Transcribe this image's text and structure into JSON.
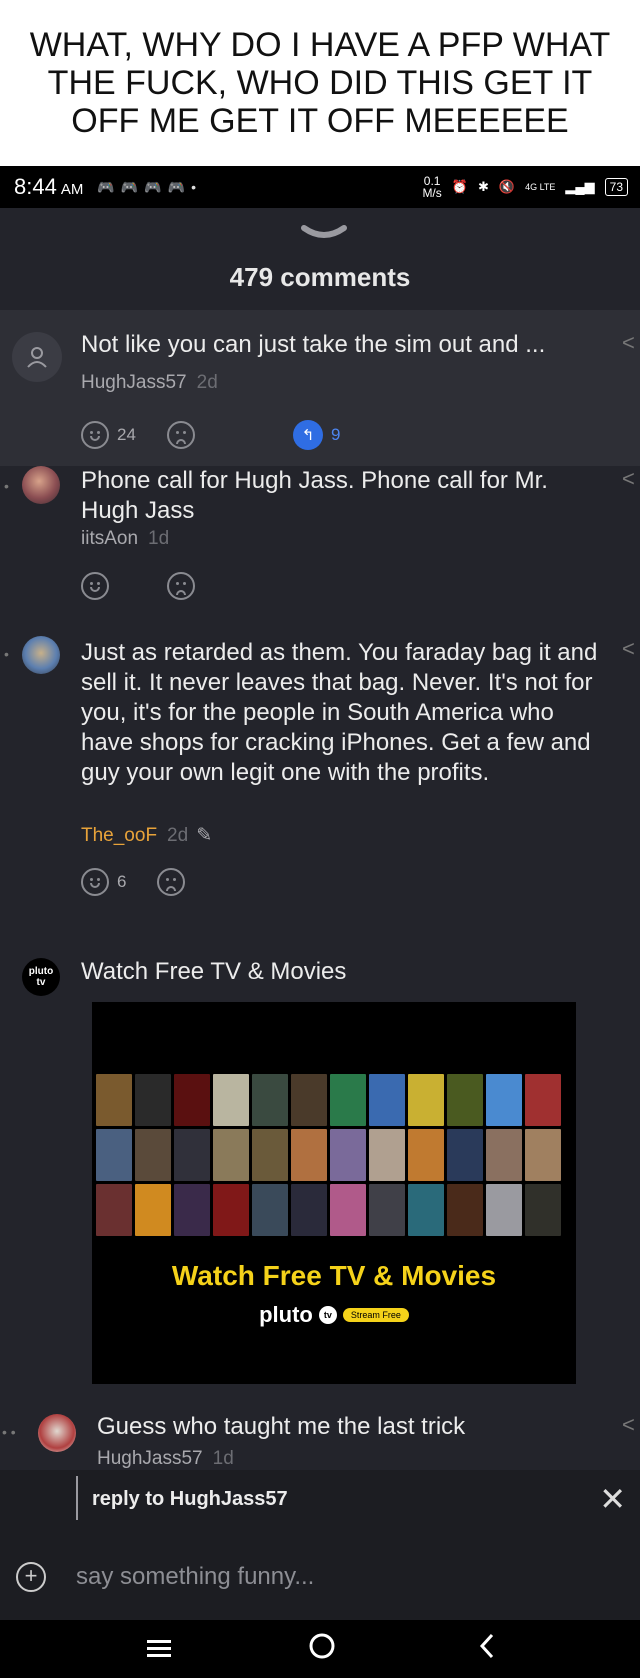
{
  "caption": "WHAT, WHY DO I HAVE A PFP WHAT THE FUCK, WHO DID THIS GET IT OFF ME GET IT OFF MEEEEEE",
  "status_bar": {
    "time": "8:44",
    "ampm": "AM",
    "speed_value": "0.1",
    "speed_unit": "M/s",
    "network": "4G LTE",
    "battery": "73"
  },
  "sheet": {
    "title": "479 comments"
  },
  "comments": [
    {
      "text": "Not like you can just take the sim out and ...",
      "author": "HughJass57",
      "age": "2d",
      "likes": "24",
      "dislikes": "",
      "replies": "9"
    },
    {
      "text": "Phone call for Hugh Jass. Phone call for Mr. Hugh Jass",
      "author": "iitsAon",
      "age": "1d",
      "likes": "",
      "dislikes": ""
    },
    {
      "text": "Just as retarded as them. You faraday bag it and sell it. It never leaves that bag. Never. It's not for you, it's for the people in South America who have shops for cracking iPhones. Get a few and guy your own legit one with the profits.",
      "author": "The_ooF",
      "age": "2d",
      "likes": "6",
      "dislikes": ""
    },
    {
      "text": "Guess who taught me the last trick",
      "author": "HughJass57",
      "age": "1d"
    }
  ],
  "ad": {
    "logo_top": "pluto",
    "logo_bottom": "tv",
    "title": "Watch Free TV & Movies",
    "headline": "Watch Free TV & Movies",
    "brand": "pluto",
    "brand_badge": "tv",
    "pill": "Stream Free"
  },
  "reply_bar": {
    "label": "reply to HughJass57"
  },
  "compose": {
    "placeholder": "say something funny..."
  },
  "colors": {
    "accent_blue": "#2f6de3",
    "op_orange": "#e8a33a",
    "ad_yellow": "#f5d21a"
  }
}
